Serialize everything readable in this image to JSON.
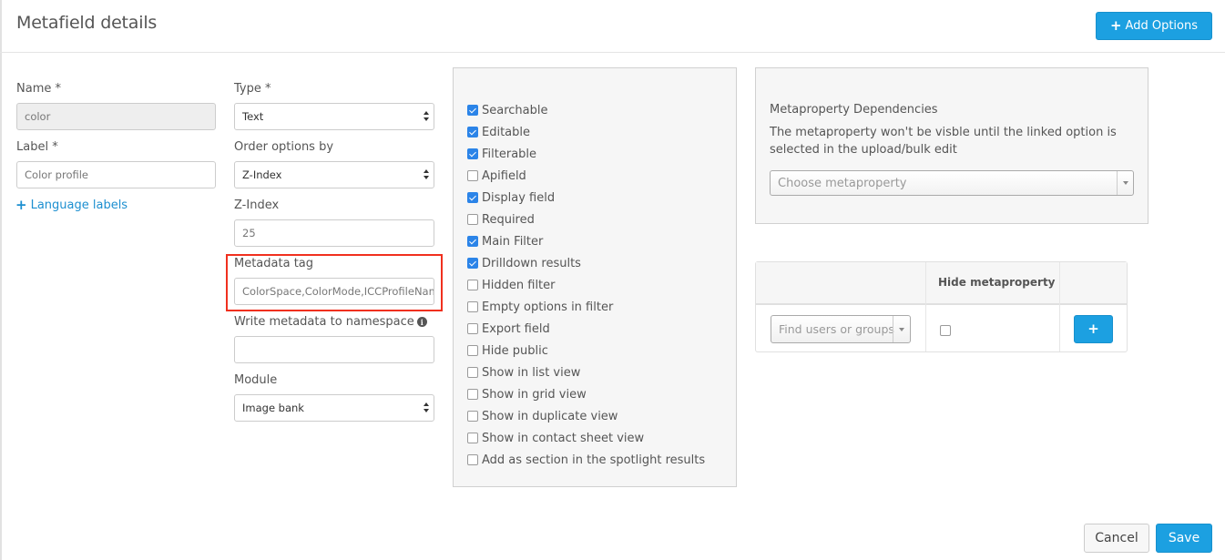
{
  "header": {
    "title": "Metafield details",
    "add_options_label": "Add Options"
  },
  "form": {
    "name": {
      "label": "Name *",
      "value": "color"
    },
    "label": {
      "label": "Label *",
      "value": "Color profile"
    },
    "language_labels_link": "Language labels",
    "type": {
      "label": "Type *",
      "value": "Text"
    },
    "order_options_by": {
      "label": "Order options by",
      "value": "Z-Index"
    },
    "z_index": {
      "label": "Z-Index",
      "value": "25"
    },
    "metadata_tag": {
      "label": "Metadata tag",
      "value": "ColorSpace,ColorMode,ICCProfileNam"
    },
    "write_namespace": {
      "label": "Write metadata to namespace",
      "value": ""
    },
    "module": {
      "label": "Module",
      "value": "Image bank"
    }
  },
  "options": [
    {
      "label": "Searchable",
      "checked": true
    },
    {
      "label": "Editable",
      "checked": true
    },
    {
      "label": "Filterable",
      "checked": true
    },
    {
      "label": "Apifield",
      "checked": false
    },
    {
      "label": "Display field",
      "checked": true
    },
    {
      "label": "Required",
      "checked": false
    },
    {
      "label": "Main Filter",
      "checked": true
    },
    {
      "label": "Drilldown results",
      "checked": true
    },
    {
      "label": "Hidden filter",
      "checked": false
    },
    {
      "label": "Empty options in filter",
      "checked": false
    },
    {
      "label": "Export field",
      "checked": false
    },
    {
      "label": "Hide public",
      "checked": false
    },
    {
      "label": "Show in list view",
      "checked": false
    },
    {
      "label": "Show in grid view",
      "checked": false
    },
    {
      "label": "Show in duplicate view",
      "checked": false
    },
    {
      "label": "Show in contact sheet view",
      "checked": false
    },
    {
      "label": "Add as section in the spotlight results",
      "checked": false
    }
  ],
  "dependencies": {
    "title": "Metaproperty Dependencies",
    "description": "The metaproperty won't be visble until the linked option is selected in the upload/bulk edit",
    "select_placeholder": "Choose metaproperty"
  },
  "permissions": {
    "column_header": "Hide metaproperty",
    "find_placeholder": "Find users or groups",
    "hide_checked": false,
    "add_label": "+"
  },
  "footer": {
    "cancel_label": "Cancel",
    "save_label": "Save"
  },
  "colors": {
    "primary": "#1ca0e1",
    "highlight": "#f0301e",
    "checkbox_checked": "#2b84e8"
  }
}
